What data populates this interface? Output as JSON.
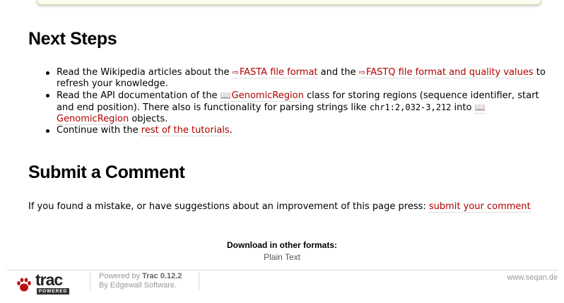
{
  "next_steps": {
    "heading": "Next Steps",
    "items": [
      {
        "pre": "Read the Wikipedia articles about the ",
        "link1": "FASTA file format",
        "mid": " and the ",
        "link2": "FASTQ file format and quality values",
        "post": " to refresh your knowledge."
      },
      {
        "pre": "Read the API documentation of the ",
        "link1": "GenomicRegion",
        "mid": " class for storing regions (sequence identifier, start and end position). There also is functionality for parsing strings like ",
        "code": "chr1:2,032-3,212",
        "mid2": " into ",
        "link2": "GenomicRegion",
        "post": " objects."
      },
      {
        "pre": "Continue with the ",
        "link1": "rest of the tutorials",
        "post": "."
      }
    ]
  },
  "submit": {
    "heading": "Submit a Comment",
    "text": "If you found a mistake, or have suggestions about an improvement of this page press: ",
    "link": "submit your comment"
  },
  "alt_formats": {
    "title": "Download in other formats:",
    "items": [
      "Plain Text"
    ]
  },
  "footer": {
    "logo_text": "trac",
    "logo_badge": "POWERED",
    "powered_by": "Powered by ",
    "trac_version": "Trac 0.12.2",
    "by_prefix": "By ",
    "by_link": "Edgewall Software",
    "by_suffix": ".",
    "site": "www.seqan.de"
  },
  "icons": {
    "external_link": "external-link-icon",
    "api_doc": "book-icon"
  },
  "colors": {
    "link": "#b00000",
    "muted": "#999999"
  }
}
